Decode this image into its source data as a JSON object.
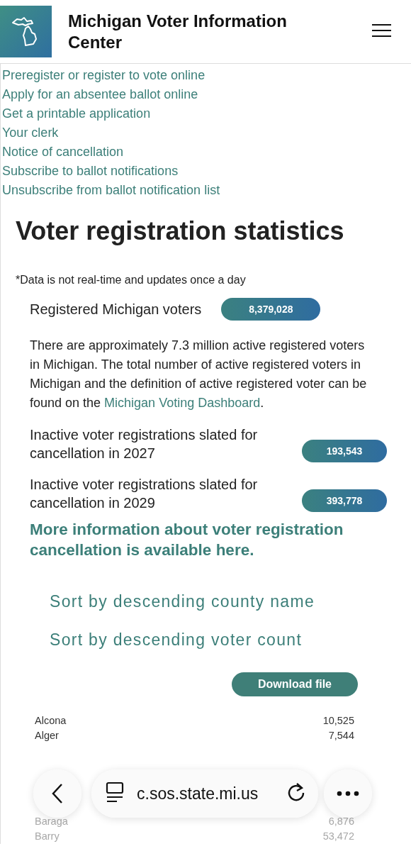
{
  "header": {
    "title": "Michigan Voter Information Center"
  },
  "nav_links": [
    "Preregister or register to vote online",
    "Apply for an absentee ballot online",
    "Get a printable application",
    "Your clerk",
    "Notice of cancellation",
    "Subscribe to ballot notifications",
    "Unsubscribe from ballot notification list"
  ],
  "heading": "Voter registration statistics",
  "note": "*Data is not real-time and updates once a day",
  "stats": [
    {
      "kind": "single",
      "label": "Registered Michigan voters",
      "value": "8,379,028"
    },
    {
      "kind": "paragraph",
      "text": "There are approximately 7.3 million active registered voters in Michigan. The total number of active registered voters in Michigan and the definition of active registered voter can be found on the ",
      "link": "Michigan Voting Dashboard",
      "after": "."
    },
    {
      "kind": "wrapped",
      "label": "Inactive voter registrations slated for cancellation in 2027",
      "value": "193,543"
    },
    {
      "kind": "wrapped",
      "label": "Inactive voter registrations slated for cancellation in 2029",
      "value": "393,778"
    }
  ],
  "more_info_link": "More information about voter registration cancellation is available here.",
  "sort_links": [
    "Sort by descending county name",
    "Sort by descending voter count"
  ],
  "download_button": "Download file",
  "table": {
    "rows": [
      {
        "county": "Alcona",
        "count": "10,525",
        "faded": false
      },
      {
        "county": "Alger",
        "count": "7,544",
        "faded": false
      },
      {
        "county": "Baraga",
        "count": "6,876",
        "faded": true
      },
      {
        "county": "Barry",
        "count": "53,472",
        "faded": true
      }
    ]
  },
  "browser_bar": {
    "url": "c.sos.state.mi.us"
  }
}
